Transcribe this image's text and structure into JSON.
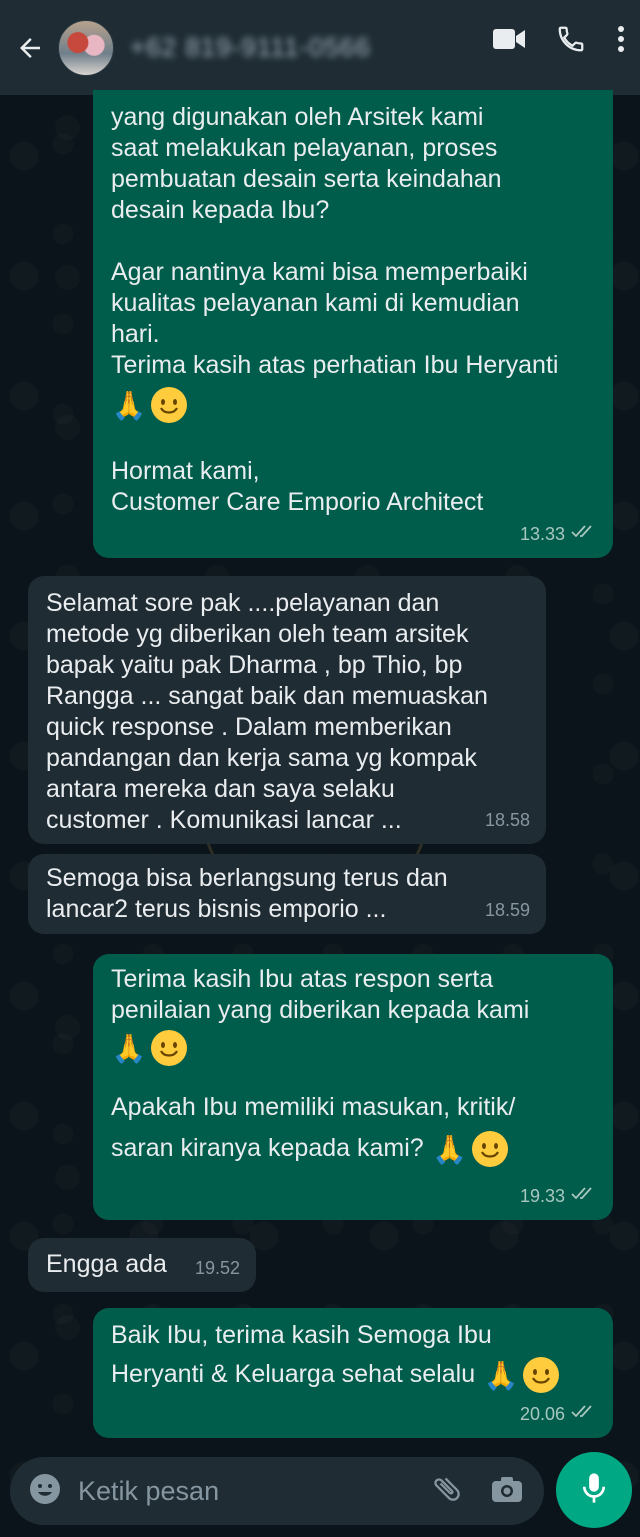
{
  "header": {
    "contact_name": "+62 819-9111-0566",
    "icons": [
      "back-arrow-icon",
      "video-call-icon",
      "phone-call-icon",
      "more-options-icon"
    ]
  },
  "messages": [
    {
      "direction": "outgoing",
      "lines": [
        "yang digunakan oleh Arsitek kami",
        "saat melakukan pelayanan, proses",
        "pembuatan desain serta keindahan",
        "desain kepada Ibu?",
        "",
        "Agar nantinya kami bisa memperbaiki",
        "kualitas pelayanan kami di kemudian",
        "hari.",
        "Terima kasih atas perhatian Ibu Heryanti",
        "[emoji]",
        "",
        "Hormat kami,",
        "Customer Care Emporio Architect"
      ],
      "time": "13.33",
      "status": "read"
    },
    {
      "direction": "incoming",
      "lines": [
        "Selamat sore pak ....pelayanan dan",
        "metode yg diberikan oleh team arsitek",
        "bapak yaitu pak Dharma , bp Thio, bp",
        "Rangga ... sangat baik dan memuaskan",
        "quick response . Dalam memberikan",
        "pandangan dan kerja sama yg kompak",
        "antara mereka dan saya selaku",
        "customer . Komunikasi lancar ..."
      ],
      "time": "18.58"
    },
    {
      "direction": "incoming",
      "lines": [
        "Semoga bisa berlangsung terus dan",
        "lancar2 terus bisnis emporio ..."
      ],
      "time": "18.59"
    },
    {
      "direction": "outgoing",
      "lines": [
        "Terima kasih Ibu atas respon serta",
        "penilaian yang diberikan kepada kami",
        "[emoji]",
        "",
        "Apakah Ibu memiliki masukan, kritik/",
        "saran kiranya kepada kami? [emoji]"
      ],
      "time": "19.33",
      "status": "read"
    },
    {
      "direction": "incoming",
      "lines": [
        "Engga ada"
      ],
      "time": "19.52"
    },
    {
      "direction": "outgoing",
      "lines": [
        "Baik Ibu, terima kasih Semoga Ibu",
        "Heryanti & Keluarga sehat selalu [emoji]"
      ],
      "time": "20.06",
      "status": "read"
    }
  ],
  "composer": {
    "placeholder": "Ketik pesan",
    "icons": [
      "emoji-icon",
      "attachment-icon",
      "camera-icon",
      "microphone-icon"
    ]
  },
  "colors": {
    "header_bg": "#1f2c34",
    "outgoing_bubble": "#005c4b",
    "incoming_bubble": "#202c33",
    "chat_bg": "#0b141a",
    "accent": "#00a884"
  }
}
